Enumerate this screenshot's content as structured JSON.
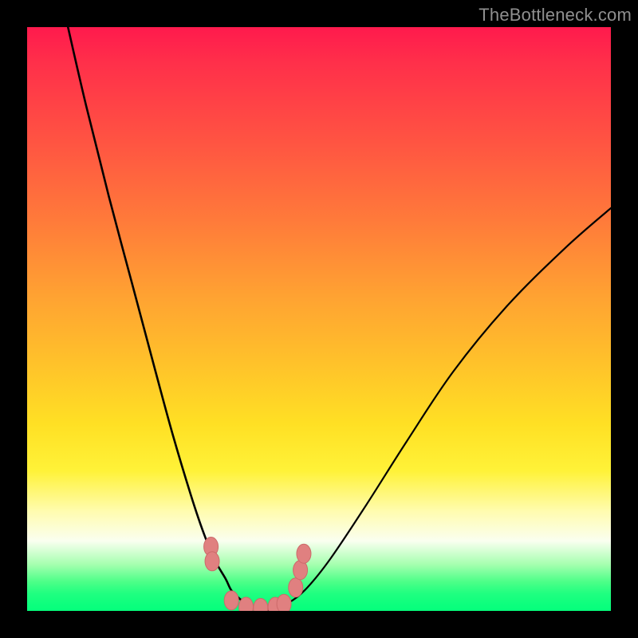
{
  "watermark": {
    "text": "TheBottleneck.com"
  },
  "chart_data": {
    "type": "line",
    "title": "",
    "xlabel": "",
    "ylabel": "",
    "xlim": [
      0,
      100
    ],
    "ylim": [
      0,
      100
    ],
    "series": [
      {
        "name": "left-curve",
        "x": [
          7,
          10,
          14,
          18,
          22,
          25,
          28,
          30,
          32,
          34,
          35,
          36.5,
          38,
          40,
          42
        ],
        "y": [
          100,
          87,
          71,
          56,
          41,
          30,
          20,
          14,
          9,
          5.5,
          3.5,
          2,
          1,
          0.3,
          0
        ]
      },
      {
        "name": "right-curve",
        "x": [
          42,
          45,
          48,
          52,
          58,
          65,
          73,
          82,
          92,
          100
        ],
        "y": [
          0,
          1.5,
          4,
          9,
          18,
          29,
          41,
          52,
          62,
          69
        ]
      },
      {
        "name": "valley-markers",
        "x": [
          31.5,
          31.7,
          35,
          37.5,
          40,
          42.5,
          44,
          46,
          46.8,
          47.4
        ],
        "y": [
          11,
          8.5,
          1.8,
          0.7,
          0.5,
          0.7,
          1.2,
          4,
          7,
          9.8
        ]
      }
    ],
    "colors": {
      "curve": "#000000",
      "marker_fill": "#e08080",
      "marker_stroke": "#cc6a6a"
    }
  }
}
